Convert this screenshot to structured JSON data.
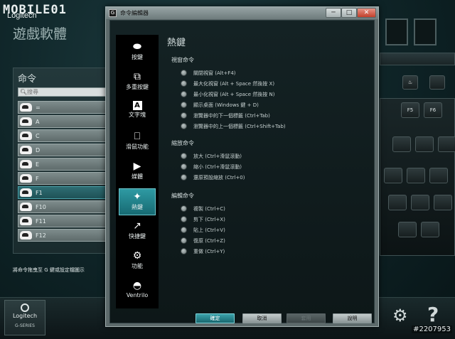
{
  "background": {
    "brand": "MOBILE01",
    "brand_sub": "Logitech",
    "app_title": "遊戲軟體",
    "command_panel": {
      "title": "命令",
      "search_placeholder": "搜尋",
      "items": [
        {
          "label": "="
        },
        {
          "label": "A"
        },
        {
          "label": "C"
        },
        {
          "label": "D"
        },
        {
          "label": "E"
        },
        {
          "label": "F"
        },
        {
          "label": "F1"
        },
        {
          "label": "F10"
        },
        {
          "label": "F11"
        },
        {
          "label": "F12"
        }
      ],
      "selected_index": 6
    },
    "hint": "將命令拖曳至 G 鍵或設定檔圖示",
    "logo": {
      "name": "Logitech",
      "series": "G-SERIES"
    },
    "keyboard_keys": {
      "f5": "F5",
      "f6": "F6"
    },
    "watermark": "#2207953"
  },
  "dialog": {
    "title": "命令編輯器",
    "window_buttons": {
      "minimize": "─",
      "maximize": "□",
      "close": "✕"
    },
    "categories": [
      {
        "label": "按鍵",
        "icon": "key-icon"
      },
      {
        "label": "多重按鍵",
        "icon": "multikey-icon"
      },
      {
        "label": "文字塊",
        "icon": "text-block-icon"
      },
      {
        "label": "滑鼠功能",
        "icon": "mouse-icon"
      },
      {
        "label": "媒體",
        "icon": "media-play-icon"
      },
      {
        "label": "熱鍵",
        "icon": "hotkey-icon"
      },
      {
        "label": "快捷鍵",
        "icon": "shortcut-arrow-icon"
      },
      {
        "label": "功能",
        "icon": "function-gear-icon"
      },
      {
        "label": "Ventrilo",
        "icon": "headset-icon"
      }
    ],
    "selected_category": 5,
    "content": {
      "heading": "熱鍵",
      "sections": [
        {
          "title": "視窗命令",
          "options": [
            "關閉視窗 (Alt+F4)",
            "最大化視窗 (Alt + Space 然後按 X)",
            "最小化視窗 (Alt + Space 然後按 N)",
            "顯示桌面 (Windows 鍵 + D)",
            "瀏覽器中的下一個標籤 (Ctrl+Tab)",
            "瀏覽器中的上一個標籤 (Ctrl+Shift+Tab)"
          ]
        },
        {
          "title": "縮放命令",
          "options": [
            "放大 (Ctrl+滑鼠滾動)",
            "縮小 (Ctrl+滑鼠滾動)",
            "還原預設縮放 (Ctrl+0)"
          ]
        },
        {
          "title": "編輯命令",
          "options": [
            "複製 (Ctrl+C)",
            "剪下 (Ctrl+X)",
            "貼上 (Ctrl+V)",
            "復原 (Ctrl+Z)",
            "重做 (Ctrl+Y)"
          ]
        }
      ]
    },
    "buttons": {
      "ok": "確定",
      "cancel": "取消",
      "apply": "套用",
      "help": "說明"
    }
  }
}
